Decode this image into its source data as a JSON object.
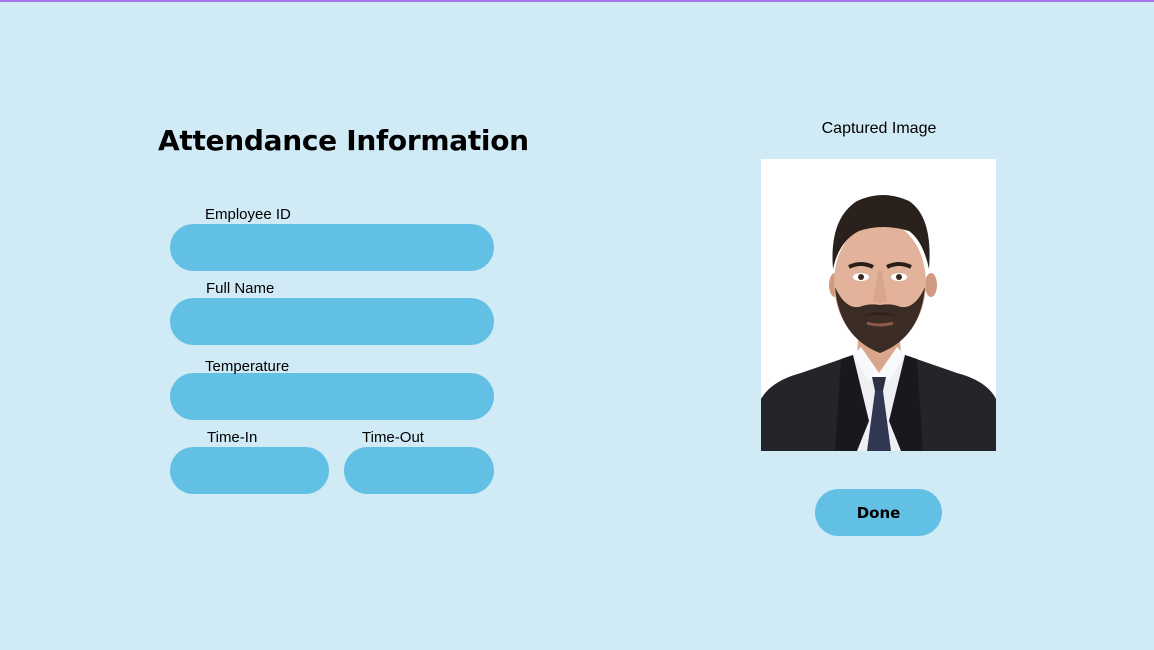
{
  "form": {
    "title": "Attendance Information",
    "fields": {
      "employee_id": {
        "label": "Employee ID",
        "value": ""
      },
      "full_name": {
        "label": "Full Name",
        "value": ""
      },
      "temperature": {
        "label": "Temperature",
        "value": ""
      },
      "time_in": {
        "label": "Time-In",
        "value": ""
      },
      "time_out": {
        "label": "Time-Out",
        "value": ""
      }
    }
  },
  "capture": {
    "label": "Captured Image",
    "image": "portrait-photo"
  },
  "actions": {
    "done_label": "Done"
  },
  "colors": {
    "background": "#d0ebf6",
    "field_fill": "#63c0e5",
    "top_accent": "#a873e8"
  }
}
